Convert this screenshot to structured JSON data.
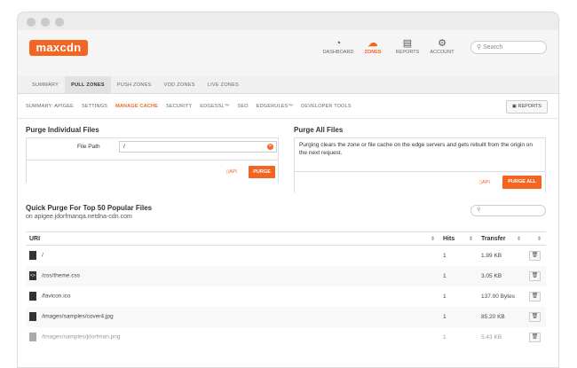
{
  "header": {
    "logo": "maxcdn",
    "nav": [
      {
        "label": "DASHBOARD",
        "icon": "speedometer-icon",
        "glyph": "◔"
      },
      {
        "label": "ZONES",
        "icon": "cloud-icon",
        "glyph": "☁"
      },
      {
        "label": "REPORTS",
        "icon": "reports-icon",
        "glyph": "▤"
      },
      {
        "label": "ACCOUNT",
        "icon": "gear-icon",
        "glyph": "⚙"
      }
    ],
    "search_placeholder": "Search"
  },
  "tabs": [
    "SUMMARY",
    "PULL ZONES",
    "PUSH ZONES",
    "VOD ZONES",
    "LIVE ZONES"
  ],
  "subnav": [
    "SUMMARY: APIGEE",
    "SETTINGS",
    "MANAGE CACHE",
    "SECURITY",
    "EDGESSL™",
    "SEO",
    "EDGERULES™",
    "DEVELOPER TOOLS"
  ],
  "reports_button": "REPORTS",
  "purge_individual": {
    "title": "Purge Individual Files",
    "file_path_label": "File Path",
    "file_path_value": "/",
    "api_label": "API",
    "purge_button": "PURGE"
  },
  "purge_all": {
    "title": "Purge All Files",
    "description": "Purging clears the zone or file cache on the edge servers and gets rebuilt from the origin on the next request.",
    "api_label": "API",
    "purge_all_button": "PURGE ALL"
  },
  "quick_purge": {
    "title": "Quick Purge For Top 50 Popular Files",
    "subtitle": "on apigee.jdorfmanqa.netdna-cdn.com",
    "columns": [
      "URI",
      "Hits",
      "Transfer"
    ],
    "rows": [
      {
        "uri": "/",
        "hits": "1",
        "transfer": "1.99 KB",
        "icon": "file-icon"
      },
      {
        "uri": "/css/theme.css",
        "hits": "1",
        "transfer": "3.05 KB",
        "icon": "code-file-icon"
      },
      {
        "uri": "/favicon.ico",
        "hits": "1",
        "transfer": "137.00 Bytes",
        "icon": "image-file-icon"
      },
      {
        "uri": "/images/samples/cover4.jpg",
        "hits": "1",
        "transfer": "85.20 KB",
        "icon": "image-file-icon"
      },
      {
        "uri": "/images/samples/jdorfman.png",
        "hits": "1",
        "transfer": "5.43 KB",
        "icon": "image-file-icon"
      }
    ]
  }
}
